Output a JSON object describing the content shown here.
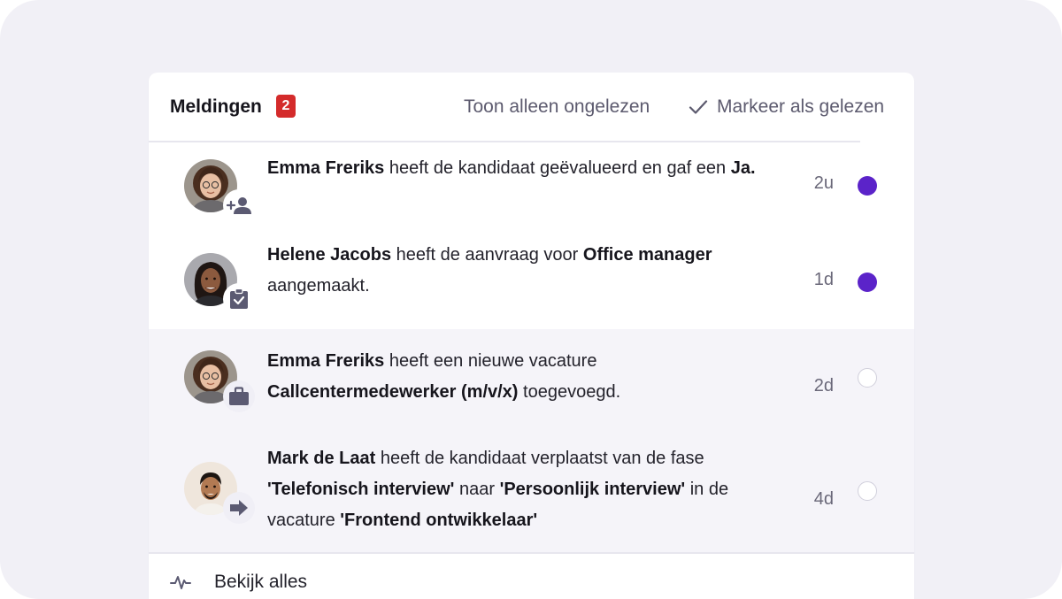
{
  "header": {
    "title": "Meldingen",
    "badge_count": "2",
    "filter_label": "Toon alleen ongelezen",
    "mark_label": "Markeer als gelezen"
  },
  "notifications": [
    {
      "segments": [
        {
          "t": "Emma Freriks",
          "b": true
        },
        {
          "t": " heeft de kandidaat geëvalueerd en gaf een ",
          "b": false
        },
        {
          "t": "Ja.",
          "b": true
        }
      ],
      "time": "2u",
      "unread": true,
      "action_icon": "add-person-icon"
    },
    {
      "segments": [
        {
          "t": "Helene Jacobs",
          "b": true
        },
        {
          "t": " heeft de aanvraag voor ",
          "b": false
        },
        {
          "t": "Office manager",
          "b": true
        },
        {
          "t": " aangemaakt.",
          "b": false
        }
      ],
      "time": "1d",
      "unread": true,
      "action_icon": "clipboard-check-icon"
    },
    {
      "segments": [
        {
          "t": "Emma Freriks",
          "b": true
        },
        {
          "t": " heeft een nieuwe vacature ",
          "b": false
        },
        {
          "t": "Callcentermedewerker (m/v/x)",
          "b": true
        },
        {
          "t": " toegevoegd.",
          "b": false
        }
      ],
      "time": "2d",
      "unread": false,
      "action_icon": "briefcase-icon"
    },
    {
      "segments": [
        {
          "t": "Mark de Laat",
          "b": true
        },
        {
          "t": " heeft de kandidaat verplaatst van de fase ",
          "b": false
        },
        {
          "t": "'Telefonisch interview'",
          "b": true
        },
        {
          "t": " naar ",
          "b": false
        },
        {
          "t": "'Persoonlijk interview'",
          "b": true
        },
        {
          "t": " in de vacature ",
          "b": false
        },
        {
          "t": "'Frontend ontwikkelaar'",
          "b": true
        }
      ],
      "time": "4d",
      "unread": false,
      "action_icon": "arrow-right-icon"
    }
  ],
  "footer": {
    "label": "Bekijk alles",
    "icon": "activity-icon"
  },
  "colors": {
    "accent": "#5b23c9",
    "badge": "#d42b2b",
    "read_row_bg": "#f5f4f9"
  }
}
